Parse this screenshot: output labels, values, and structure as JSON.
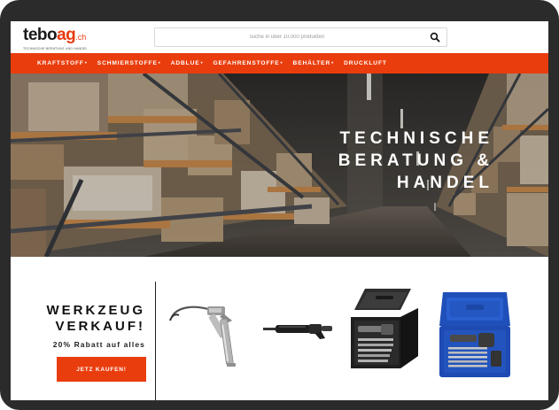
{
  "brand": {
    "name_black": "tebo",
    "name_red": "ag",
    "tld": ".ch",
    "tagline": "TECHNISCHE BERATUNG UND HANDEL"
  },
  "search": {
    "placeholder": "suche in uber 10,000 produkten",
    "icon": "search-icon"
  },
  "nav": {
    "items": [
      {
        "label": "KRAFTSTOFF",
        "dropdown": true
      },
      {
        "label": "SCHMIERSTOFFE",
        "dropdown": true
      },
      {
        "label": "ADBLUE",
        "dropdown": true
      },
      {
        "label": "GEFAHRENSTOFFE",
        "dropdown": true
      },
      {
        "label": "BEHÄLTER",
        "dropdown": true
      },
      {
        "label": "DRUCKLUFT",
        "dropdown": false
      }
    ]
  },
  "hero": {
    "line1": "TECHNISCHE",
    "line2": "BERATUNG &",
    "line3": "HANDEL"
  },
  "promo": {
    "title_line1": "WERKZEUG",
    "title_line2": "VERKAUF!",
    "subtitle": "20% Rabatt auf alles",
    "cta_label": "JETZ KAUFEN!"
  },
  "products": [
    {
      "name": "grease-gun"
    },
    {
      "name": "air-hammer"
    },
    {
      "name": "air-hammer-kit-black-case"
    },
    {
      "name": "air-hammer-kit-blue-case"
    }
  ],
  "colors": {
    "accent": "#ea3d0d",
    "device_frame": "#2b2b2b"
  }
}
